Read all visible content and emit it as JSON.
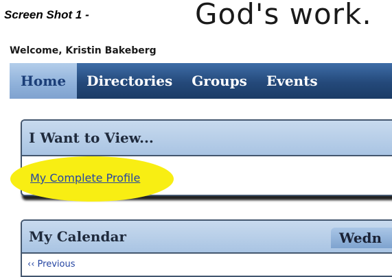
{
  "caption": "Screen Shot 1 -",
  "brand_text": "God's work.",
  "welcome_text": "Welcome, Kristin Bakeberg",
  "nav": {
    "items": [
      {
        "label": "Home",
        "active": true
      },
      {
        "label": "Directories"
      },
      {
        "label": "Groups"
      },
      {
        "label": "Events"
      }
    ]
  },
  "view_panel": {
    "title": "I Want to View...",
    "link_label": "My Complete Profile",
    "highlight_color": "#f8ee13"
  },
  "calendar_panel": {
    "title": "My Calendar",
    "date_tab": "Wedn",
    "previous_label": "Previous"
  },
  "colors": {
    "nav_bar": "#24497a",
    "nav_active": "#8fb1da",
    "panel_header": "#a9c4e3",
    "link": "#2545a2"
  }
}
